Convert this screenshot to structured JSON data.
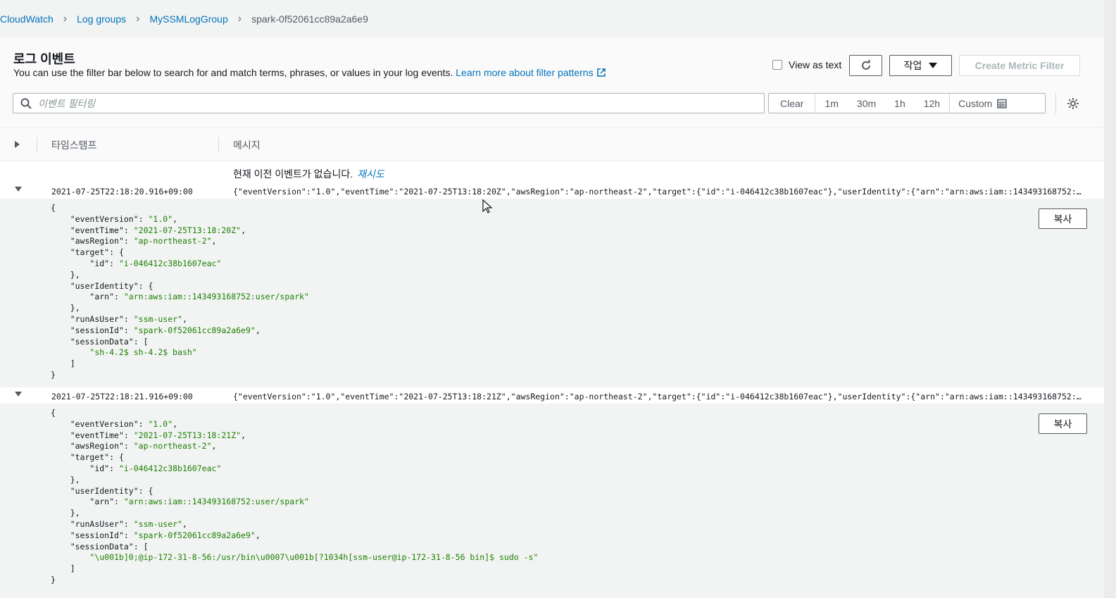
{
  "breadcrumb": {
    "items": [
      "CloudWatch",
      "Log groups",
      "MySSMLogGroup"
    ],
    "current": "spark-0f52061cc89a2a6e9"
  },
  "header": {
    "title": "로그 이벤트",
    "description": "You can use the filter bar below to search for and match terms, phrases, or values in your log events.",
    "learn_more": "Learn more about filter patterns",
    "view_as_text": "View as text",
    "actions_label": "작업",
    "create_metric_filter": "Create Metric Filter"
  },
  "filter": {
    "placeholder": "이벤트 필터링",
    "ranges": [
      "Clear",
      "1m",
      "30m",
      "1h",
      "12h"
    ],
    "custom": "Custom"
  },
  "table": {
    "col_timestamp": "타임스탬프",
    "col_message": "메시지",
    "no_prev": "현재 이전 이벤트가 없습니다.",
    "retry": "재시도"
  },
  "events": [
    {
      "timestamp": "2021-07-25T22:18:20.916+09:00",
      "message": "{\"eventVersion\":\"1.0\",\"eventTime\":\"2021-07-25T13:18:20Z\",\"awsRegion\":\"ap-northeast-2\",\"target\":{\"id\":\"i-046412c38b1607eac\"},\"userIdentity\":{\"arn\":\"arn:aws:iam::143493168752:user/spark\"},\"runAsUser\":\"ssm-user\",\"sessionId\":\"spark-0f52061cc89a2a6e9\",\"sessionData\":[\"sh-4.2$ sh-4.2$ bash\"]}",
      "event_version": "\"1.0\"",
      "event_time": "\"2021-07-25T13:18:20Z\"",
      "aws_region": "\"ap-northeast-2\"",
      "target_id": "\"i-046412c38b1607eac\"",
      "arn": "\"arn:aws:iam::143493168752:user/spark\"",
      "run_as_user": "\"ssm-user\"",
      "session_id": "\"spark-0f52061cc89a2a6e9\"",
      "session_data": "\"sh-4.2$ sh-4.2$ bash\"",
      "copy_label": "복사"
    },
    {
      "timestamp": "2021-07-25T22:18:21.916+09:00",
      "message": "{\"eventVersion\":\"1.0\",\"eventTime\":\"2021-07-25T13:18:21Z\",\"awsRegion\":\"ap-northeast-2\",\"target\":{\"id\":\"i-046412c38b1607eac\"},\"userIdentity\":{\"arn\":\"arn:aws:iam::143493168752:user/spark\"},\"runAsUser\":\"ssm-user\",\"sessionId\":\"spark-0f52061cc89a2a6e9\",\"sessionData\":[\"\\u001b]0;@ip-172-31-8-56:/usr/bin\\u0007\\u001b[?1034h[ssm-user@ip-172-31-8-56 bin]$ sudo -s\"]}",
      "event_version": "\"1.0\"",
      "event_time": "\"2021-07-25T13:18:21Z\"",
      "aws_region": "\"ap-northeast-2\"",
      "target_id": "\"i-046412c38b1607eac\"",
      "arn": "\"arn:aws:iam::143493168752:user/spark\"",
      "run_as_user": "\"ssm-user\"",
      "session_id": "\"spark-0f52061cc89a2a6e9\"",
      "session_data": "\"\\u001b]0;@ip-172-31-8-56:/usr/bin\\u0007\\u001b[?1034h[ssm-user@ip-172-31-8-56 bin]$ sudo -s\"",
      "copy_label": "복사"
    }
  ],
  "json_keys": {
    "event_version": "\"eventVersion\"",
    "event_time": "\"eventTime\"",
    "aws_region": "\"awsRegion\"",
    "target": "\"target\"",
    "id": "\"id\"",
    "user_identity": "\"userIdentity\"",
    "arn": "\"arn\"",
    "run_as_user": "\"runAsUser\"",
    "session_id": "\"sessionId\"",
    "session_data": "\"sessionData\""
  },
  "colors": {
    "link": "#0073bb",
    "json_string": "#1d8102",
    "border": "#545b64"
  }
}
